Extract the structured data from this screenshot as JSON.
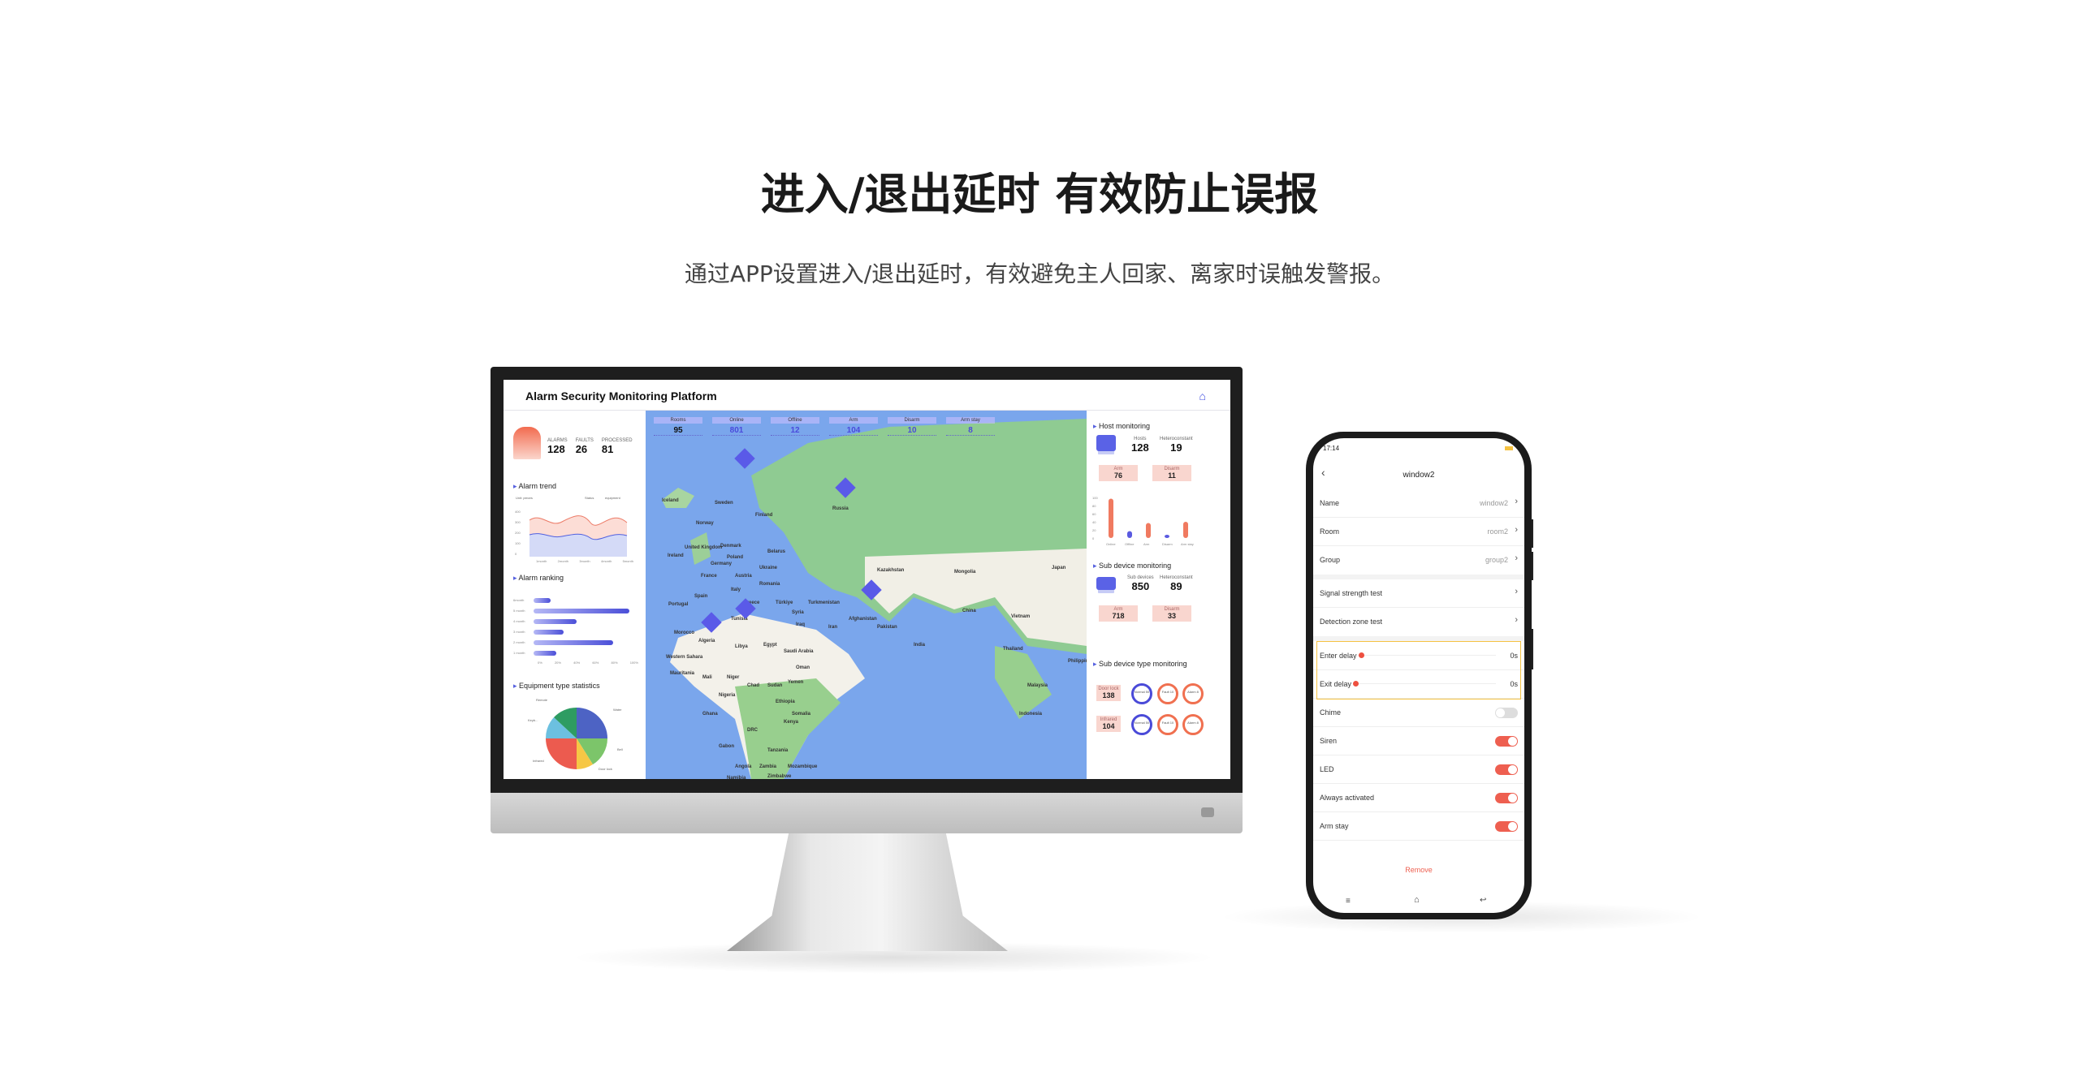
{
  "heading": "进入/退出延时 有效防止误报",
  "subheading": "通过APP设置进入/退出延时，有效避免主人回家、离家时误触发警报。",
  "dashboard": {
    "title": "Alarm Security Monitoring Platform",
    "home_icon": "home-icon",
    "summary": {
      "alarms_label": "ALARMS",
      "alarms": "128",
      "faults_label": "FAULTS",
      "faults": "26",
      "processed_label": "PROCESSED",
      "processed": "81"
    },
    "alarm_trend": {
      "title": "Alarm trend",
      "unit": "Unit: pieces",
      "legend": [
        "Status",
        "equipment"
      ],
      "y_ticks": [
        "400",
        "300",
        "200",
        "100",
        "0"
      ],
      "x_ticks": [
        "1month",
        "2month",
        "3month",
        "4month",
        "5month"
      ]
    },
    "alarm_ranking": {
      "title": "Alarm ranking",
      "rows": [
        {
          "label": "6month",
          "pct": 18
        },
        {
          "label": "5 month",
          "pct": 100
        },
        {
          "label": "4 month",
          "pct": 45
        },
        {
          "label": "3 month",
          "pct": 31
        },
        {
          "label": "2 month",
          "pct": 83
        },
        {
          "label": "1 month",
          "pct": 24
        }
      ],
      "x_ticks": [
        "0%",
        "20%",
        "40%",
        "60%",
        "80%",
        "100%"
      ]
    },
    "equipment": {
      "title": "Equipment type statistics",
      "labels": [
        "Remote",
        "Water",
        "Keyb...",
        "Bell",
        "Infrared",
        "Door lock"
      ]
    },
    "map_stats": [
      {
        "label": "Rooms",
        "value": "95"
      },
      {
        "label": "Online",
        "value": "801"
      },
      {
        "label": "Offline",
        "value": "12"
      },
      {
        "label": "Arm",
        "value": "104"
      },
      {
        "label": "Disarm",
        "value": "10"
      },
      {
        "label": "Arm stay",
        "value": "8"
      }
    ],
    "countries": [
      "Iceland",
      "Sweden",
      "Finland",
      "Norway",
      "Russia",
      "United Kingdom",
      "Ireland",
      "Denmark",
      "Belarus",
      "Poland",
      "Germany",
      "Ukraine",
      "France",
      "Austria",
      "Romania",
      "Kazakhstan",
      "Italy",
      "Spain",
      "Portugal",
      "Greece",
      "Türkiye",
      "Turkmenistan",
      "Mongolia",
      "Syria",
      "Iraq",
      "Iran",
      "Afghanistan",
      "Pakistan",
      "Tunisia",
      "Morocco",
      "Algeria",
      "Libya",
      "Egypt",
      "Saudi Arabia",
      "Oman",
      "China",
      "India",
      "Western Sahara",
      "Mauritania",
      "Mali",
      "Niger",
      "Chad",
      "Sudan",
      "Yemen",
      "Ethiopia",
      "Nigeria",
      "Ghana",
      "Kenya",
      "Somalia",
      "Gabon",
      "DRC",
      "Tanzania",
      "Angola",
      "Zambia",
      "Mozambique",
      "Namibia",
      "Zimbabwe",
      "Thailand",
      "Vietnam",
      "Philippines",
      "Malaysia",
      "Indonesia",
      "Japan"
    ],
    "host": {
      "title": "Host monitoring",
      "hosts_label": "Hosts",
      "hosts": "128",
      "hetero_label": "Heteroconstant",
      "hetero": "19",
      "arm_label": "Arm",
      "arm": "76",
      "disarm_label": "Disarm",
      "disarm": "11",
      "chart": {
        "y_ticks": [
          "100",
          "80",
          "60",
          "40",
          "20",
          "0"
        ],
        "categories": [
          "Online",
          "Offline",
          "Arm",
          "Disarm",
          "Arm stay"
        ],
        "values": [
          97,
          17,
          37,
          8,
          40
        ]
      }
    },
    "sub": {
      "title": "Sub device monitoring",
      "devices_label": "Sub devices",
      "devices": "850",
      "hetero_label": "Heteroconstant",
      "hetero": "89",
      "arm_label": "Arm",
      "arm": "718",
      "disarm_label": "Disarm",
      "disarm": "33"
    },
    "subtype": {
      "title": "Sub device type monitoring",
      "rows": [
        {
          "label": "Door lock",
          "value": "138",
          "normal": "Normal 50",
          "fault": "Fault 10",
          "alarm": "Alarm 8"
        },
        {
          "label": "Infrared",
          "value": "104",
          "normal": "Normal 50",
          "fault": "Fault 10",
          "alarm": "Alarm 8"
        }
      ]
    }
  },
  "phone": {
    "time": "17:14",
    "title": "window2",
    "name_label": "Name",
    "name_value": "window2",
    "room_label": "Room",
    "room_value": "room2",
    "group_label": "Group",
    "group_value": "group2",
    "signal_label": "Signal strength test",
    "detection_label": "Detection zone test",
    "enter_label": "Enter delay",
    "enter_value": "0s",
    "exit_label": "Exit delay",
    "exit_value": "0s",
    "chime_label": "Chime",
    "chime_on": false,
    "siren_label": "Siren",
    "siren_on": true,
    "led_label": "LED",
    "led_on": true,
    "always_label": "Always activated",
    "always_on": true,
    "armstay_label": "Arm stay",
    "armstay_on": true,
    "remove_label": "Remove",
    "accent": "#ee5f50",
    "highlight": "#f5c242"
  }
}
